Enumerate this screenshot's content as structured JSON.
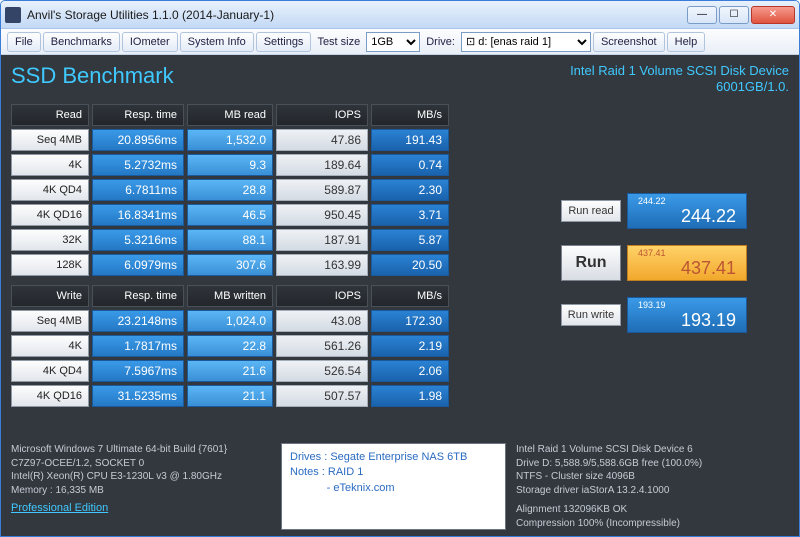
{
  "window": {
    "title": "Anvil's Storage Utilities 1.1.0 (2014-January-1)"
  },
  "menu": {
    "file": "File",
    "benchmarks": "Benchmarks",
    "iometer": "IOmeter",
    "system_info": "System Info",
    "settings": "Settings",
    "testsize_lbl": "Test size",
    "testsize_val": "1GB",
    "drive_lbl": "Drive:",
    "drive_val": "⊡ d: [enas raid 1]",
    "screenshot": "Screenshot",
    "help": "Help"
  },
  "header": {
    "title": "SSD Benchmark",
    "device": "Intel Raid 1 Volume SCSI Disk Device",
    "capacity": "6001GB/1.0."
  },
  "read": {
    "hdr": {
      "label": "Read",
      "resp": "Resp. time",
      "mb": "MB read",
      "iops": "IOPS",
      "mbs": "MB/s"
    },
    "rows": [
      {
        "label": "Seq 4MB",
        "resp": "20.8956ms",
        "mb": "1,532.0",
        "iops": "47.86",
        "mbs": "191.43"
      },
      {
        "label": "4K",
        "resp": "5.2732ms",
        "mb": "9.3",
        "iops": "189.64",
        "mbs": "0.74"
      },
      {
        "label": "4K QD4",
        "resp": "6.7811ms",
        "mb": "28.8",
        "iops": "589.87",
        "mbs": "2.30"
      },
      {
        "label": "4K QD16",
        "resp": "16.8341ms",
        "mb": "46.5",
        "iops": "950.45",
        "mbs": "3.71"
      },
      {
        "label": "32K",
        "resp": "5.3216ms",
        "mb": "88.1",
        "iops": "187.91",
        "mbs": "5.87"
      },
      {
        "label": "128K",
        "resp": "6.0979ms",
        "mb": "307.6",
        "iops": "163.99",
        "mbs": "20.50"
      }
    ]
  },
  "write": {
    "hdr": {
      "label": "Write",
      "resp": "Resp. time",
      "mb": "MB written",
      "iops": "IOPS",
      "mbs": "MB/s"
    },
    "rows": [
      {
        "label": "Seq 4MB",
        "resp": "23.2148ms",
        "mb": "1,024.0",
        "iops": "43.08",
        "mbs": "172.30"
      },
      {
        "label": "4K",
        "resp": "1.7817ms",
        "mb": "22.8",
        "iops": "561.26",
        "mbs": "2.19"
      },
      {
        "label": "4K QD4",
        "resp": "7.5967ms",
        "mb": "21.6",
        "iops": "526.54",
        "mbs": "2.06"
      },
      {
        "label": "4K QD16",
        "resp": "31.5235ms",
        "mb": "21.1",
        "iops": "507.57",
        "mbs": "1.98"
      }
    ]
  },
  "run": {
    "read_btn": "Run read",
    "write_btn": "Run write",
    "run_btn": "Run",
    "read_small": "244.22",
    "read_big": "244.22",
    "write_small": "193.19",
    "write_big": "193.19",
    "total_small": "437.41",
    "total_big": "437.41"
  },
  "sys": {
    "l1": "Microsoft Windows 7 Ultimate  64-bit Build {7601}",
    "l2": "C7Z97-OCEE/1.2, SOCKET 0",
    "l3": "Intel(R) Xeon(R) CPU E3-1230L v3 @ 1.80GHz",
    "l4": "Memory : 16,335 MB",
    "prof": "Professional Edition"
  },
  "notes": {
    "l1": "Drives : Segate Enterprise NAS 6TB",
    "l2": "Notes : RAID 1",
    "l3": "            - eTeknix.com"
  },
  "drive": {
    "l1": "Intel Raid 1 Volume SCSI Disk Device 6",
    "l2": "Drive D: 5,588.9/5,588.6GB free (100.0%)",
    "l3": "NTFS - Cluster size 4096B",
    "l4": "Storage driver  iaStorA 13.2.4.1000",
    "l5": "Alignment 132096KB OK",
    "l6": "Compression 100% (Incompressible)"
  }
}
